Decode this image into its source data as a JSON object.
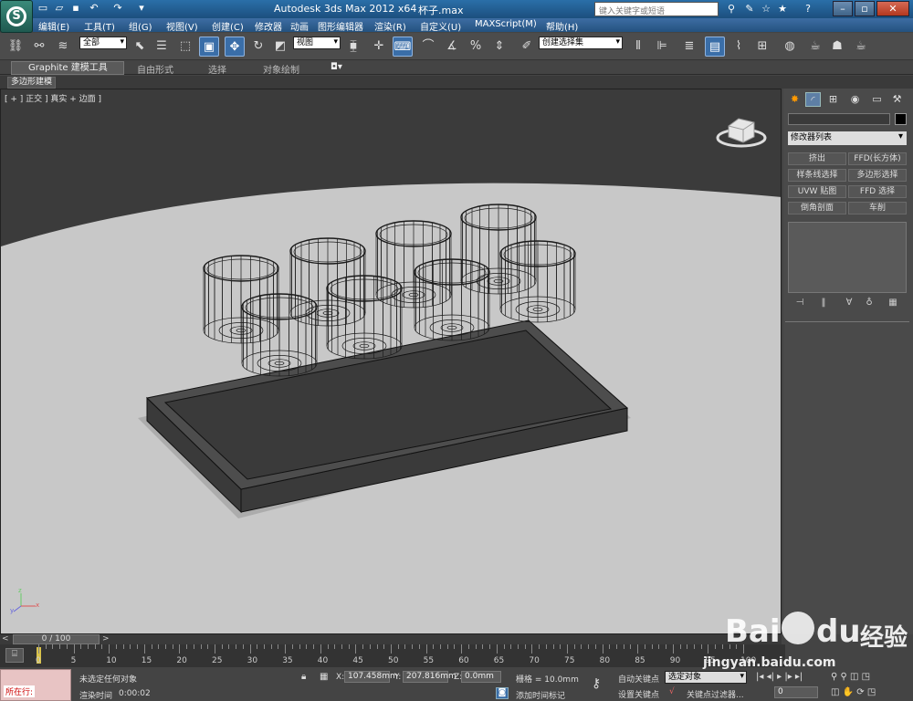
{
  "titlebar": {
    "app_title": "Autodesk 3ds Max  2012 x64",
    "file_title": "杯子.max",
    "search_placeholder": "键入关键字或短语"
  },
  "menubar": [
    "编辑(E)",
    "工具(T)",
    "组(G)",
    "视图(V)",
    "创建(C)",
    "修改器",
    "动画",
    "图形编辑器",
    "渲染(R)",
    "自定义(U)",
    "MAXScript(M)",
    "帮助(H)"
  ],
  "toolbar": {
    "selection_filter": "全部",
    "ref_coord": "视图",
    "named_selection": "创建选择集"
  },
  "ribbon": {
    "tabs": [
      "Graphite 建模工具",
      "自由形式",
      "选择",
      "对象绘制"
    ],
    "panel_label": "多边形建模"
  },
  "viewport": {
    "label": "[ + ] 正交 ] 真实 + 边面 ]",
    "axis_x": "x",
    "axis_y": "y",
    "axis_z": "z"
  },
  "command_panel": {
    "modifier_list": "修改器列表",
    "modifier_buttons": [
      "挤出",
      "FFD(长方体)",
      "样条线选择",
      "多边形选择",
      "UVW 贴图",
      "FFD 选择",
      "倒角剖面",
      "车削"
    ]
  },
  "timeline": {
    "slider_label": "0 / 100",
    "ticks": [
      "0",
      "5",
      "10",
      "15",
      "20",
      "25",
      "30",
      "35",
      "40",
      "45",
      "50",
      "55",
      "60",
      "65",
      "70",
      "75",
      "80",
      "85",
      "90",
      "95",
      "100"
    ]
  },
  "status": {
    "maxscript_label": "所在行:",
    "selection_status": "未选定任何对象",
    "render_time_label": "渲染时间",
    "render_time": "0:00:02",
    "x_label": "X:",
    "x_value": "107.458mm",
    "y_label": "Y:",
    "y_value": "207.816mm",
    "z_label": "Z:",
    "z_value": "0.0mm",
    "grid": "栅格 = 10.0mm",
    "add_time_tag": "添加时间标记",
    "auto_key": "自动关键点",
    "auto_key_mode": "选定对象",
    "set_key": "设置关键点",
    "key_filters": "关键点过滤器...",
    "frame": "0"
  },
  "watermark": {
    "brand": "Bai",
    "brand2": "du",
    "jingyan": "经验",
    "url": "jingyan.baidu.com"
  }
}
